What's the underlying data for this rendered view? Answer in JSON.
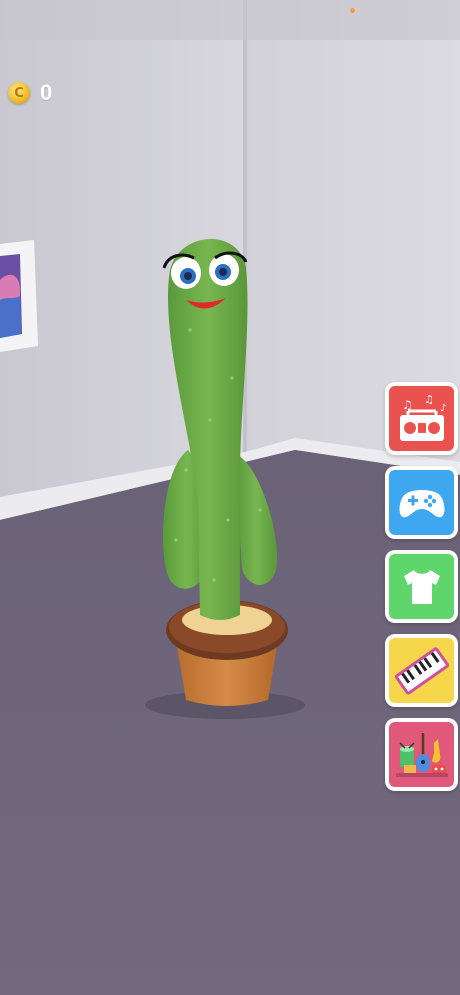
{
  "hud": {
    "coin_count": "0",
    "coin_symbol": "C"
  },
  "side_menu": {
    "buttons": [
      {
        "name": "music-radio",
        "icon": "boombox-icon"
      },
      {
        "name": "games",
        "icon": "gamepad-icon"
      },
      {
        "name": "outfits",
        "icon": "tshirt-icon"
      },
      {
        "name": "piano",
        "icon": "piano-icon"
      },
      {
        "name": "instruments",
        "icon": "instruments-icon"
      }
    ]
  },
  "colors": {
    "wall": "#cfced6",
    "floor": "#6f6579",
    "cactus": "#6cab46",
    "pot": "#c8803c",
    "radio_button": "#e9524f",
    "game_button": "#3fa6f0",
    "shirt_button": "#5ed66c",
    "piano_button": "#f6d64a",
    "instruments_button": "#e0587a"
  }
}
